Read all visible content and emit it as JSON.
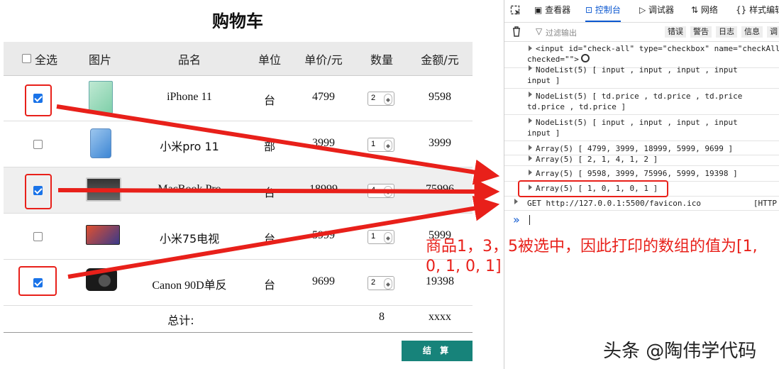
{
  "cart": {
    "title": "购物车",
    "headers": {
      "select_all": "全选",
      "image": "图片",
      "name": "品名",
      "unit": "单位",
      "price": "单价/元",
      "qty": "数量",
      "amount": "金额/元"
    },
    "rows": [
      {
        "checked": true,
        "name": "iPhone 11",
        "unit": "台",
        "price": "4799",
        "qty": "2",
        "amount": "9598"
      },
      {
        "checked": false,
        "name": "小米pro 11",
        "unit": "部",
        "price": "3999",
        "qty": "1",
        "amount": "3999"
      },
      {
        "checked": true,
        "name": "MacBook Pro",
        "unit": "台",
        "price": "18999",
        "qty": "4",
        "amount": "75996"
      },
      {
        "checked": false,
        "name": "小米75电视",
        "unit": "台",
        "price": "5999",
        "qty": "1",
        "amount": "5999"
      },
      {
        "checked": true,
        "name": "Canon 90D单反",
        "unit": "台",
        "price": "9699",
        "qty": "2",
        "amount": "19398"
      }
    ],
    "total_label": "总计:",
    "total_qty": "8",
    "total_amount": "xxxx",
    "checkout_label": "结 算"
  },
  "devtools": {
    "tabs": [
      "查看器",
      "控制台",
      "调试器",
      "网络",
      "样式编辑"
    ],
    "active_tab": "控制台",
    "filter_placeholder": "过滤输出",
    "levels": [
      "错误",
      "警告",
      "日志",
      "信息",
      "调"
    ],
    "logs": {
      "l1a": "<input id=\"check-all\" type=\"checkbox\" name=\"checkAll\"",
      "l1b": "checked=\"\">",
      "l2a": "NodeList(5) [ input , input , input , input",
      "l2b": "input ]",
      "l3a": "NodeList(5) [ td.price , td.price , td.price",
      "l3b": "td.price , td.price ]",
      "l4a": "NodeList(5) [ input , input , input , input",
      "l4b": "input ]",
      "l5": "Array(5) [ 4799, 3999, 18999, 5999, 9699 ]",
      "l6": "Array(5) [ 2, 1, 4, 1, 2 ]",
      "l7": "Array(5) [ 9598, 3999, 75996, 5999, 19398 ]",
      "l8": "Array(5) [ 1, 0, 1, 0, 1 ]",
      "l9": "GET http://127.0.0.1:5500/favicon.ico",
      "l9b": "[HTTP",
      "prompt": "»"
    }
  },
  "annotation": "商品1，3，5被选中，因此打印的数组的值为[1, 0, 1, 0, 1]",
  "watermark": "头条 @陶伟学代码",
  "colors": {
    "accent_red": "#e8201a",
    "checkout": "#17837a",
    "link_blue": "#0b57d0"
  }
}
